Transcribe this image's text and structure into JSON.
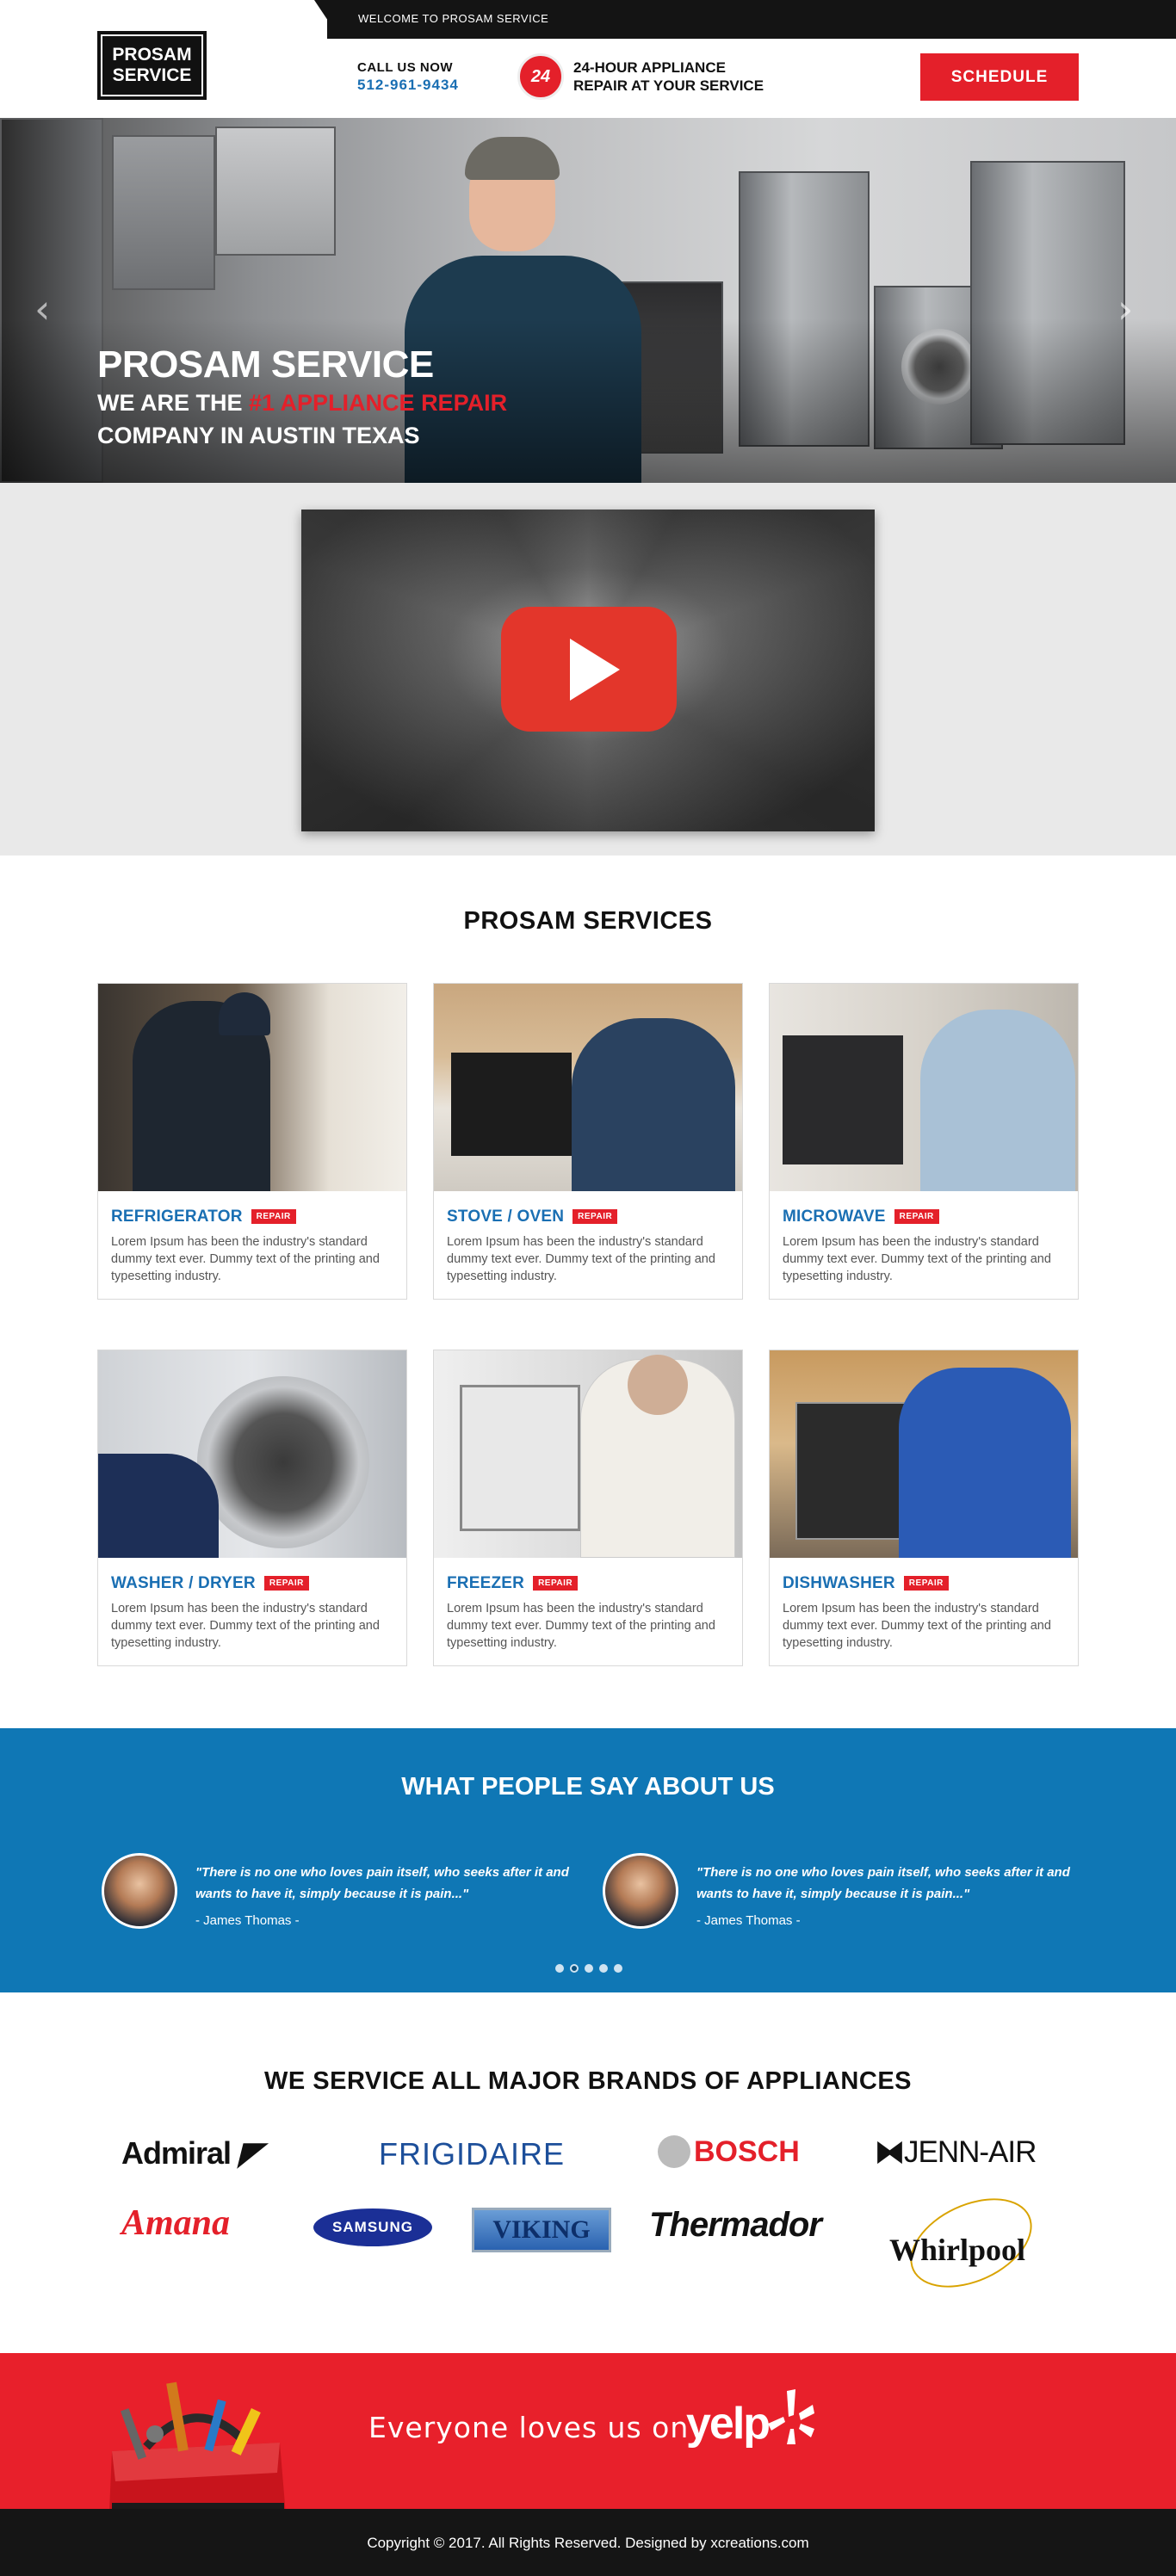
{
  "topbar": {
    "welcome": "WELCOME TO PROSAM SERVICE"
  },
  "header": {
    "logo_line1": "PROSAM",
    "logo_line2": "SERVICE",
    "call_label": "CALL US NOW",
    "phone": "512-961-9434",
    "badge": "24",
    "hours_line1": "24-HOUR APPLIANCE",
    "hours_line2": "REPAIR AT YOUR SERVICE",
    "schedule_label": "SCHEDULE"
  },
  "hero": {
    "title": "PROSAM SERVICE",
    "line2_prefix": "WE ARE THE ",
    "line2_highlight": "#1 APPLIANCE REPAIR",
    "line3": "COMPANY IN AUSTIN TEXAS",
    "prev_icon": "chevron-left-icon",
    "next_icon": "chevron-right-icon"
  },
  "video": {
    "icon": "play-icon"
  },
  "services": {
    "title": "PROSAM SERVICES",
    "tag": "REPAIR",
    "items": [
      {
        "name": "REFRIGERATOR",
        "desc": "Lorem Ipsum has been the industry's standard dummy text ever. Dummy text of the printing and typesetting industry."
      },
      {
        "name": "STOVE / OVEN",
        "desc": "Lorem Ipsum has been the industry's standard dummy text ever. Dummy text of the printing and typesetting industry."
      },
      {
        "name": "MICROWAVE",
        "desc": "Lorem Ipsum has been the industry's standard dummy text ever. Dummy text of the printing and typesetting industry."
      },
      {
        "name": "WASHER / DRYER",
        "desc": "Lorem Ipsum has been the industry's standard dummy text ever. Dummy text of the printing and typesetting industry."
      },
      {
        "name": "FREEZER",
        "desc": "Lorem Ipsum has been the industry's standard dummy text ever. Dummy text of the printing and typesetting industry."
      },
      {
        "name": "DISHWASHER",
        "desc": "Lorem Ipsum has been the industry's standard dummy text ever. Dummy text of the printing and typesetting industry."
      }
    ]
  },
  "testimonials": {
    "title": "WHAT PEOPLE SAY ABOUT US",
    "items": [
      {
        "quote": "\"There is no one who loves pain itself, who seeks after it and wants to have it, simply because it is pain...\"",
        "author": "- James Thomas -"
      },
      {
        "quote": "\"There is no one who loves pain itself, who seeks after it and wants to have it, simply because it is pain...\"",
        "author": "- James Thomas -"
      }
    ],
    "dots": 5,
    "active_dot": 2
  },
  "brands": {
    "title": "WE SERVICE ALL MAJOR BRANDS OF APPLIANCES",
    "row1": [
      "Admiral",
      "FRIGIDAIRE",
      "BOSCH",
      "JENN-AIR"
    ],
    "row2": [
      "Amana",
      "SAMSUNG",
      "VIKING",
      "Thermador",
      "Whirlpool"
    ]
  },
  "yelp": {
    "text": "Everyone  loves us on",
    "logo": "yelp"
  },
  "footer": {
    "copyright": "Copyright © 2017. All Rights Reserved. Designed by xcreations.com"
  },
  "colors": {
    "accent_red": "#e4202a",
    "brand_blue": "#1a6fb3",
    "testimonial_bg": "#0f77b5",
    "dark": "#141414"
  }
}
